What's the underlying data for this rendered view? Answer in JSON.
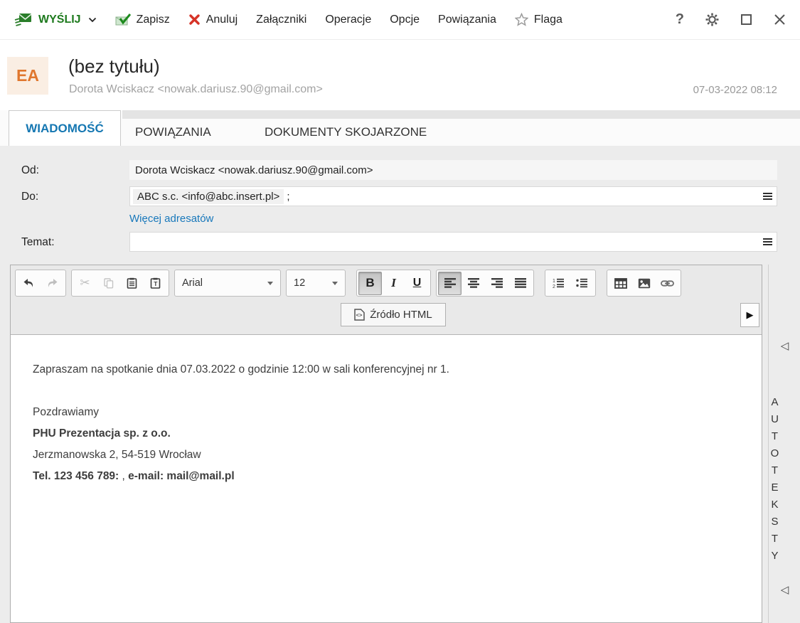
{
  "toolbar": {
    "send_label": "WYŚLIJ",
    "save_label": "Zapisz",
    "cancel_label": "Anuluj",
    "attachments_label": "Załączniki",
    "operations_label": "Operacje",
    "options_label": "Opcje",
    "relations_label": "Powiązania",
    "flag_label": "Flaga",
    "help_label": "?"
  },
  "header": {
    "avatar_initials": "EA",
    "title": "(bez tytułu)",
    "sender_line": "Dorota Wciskacz <nowak.dariusz.90@gmail.com>",
    "datetime": "07-03-2022 08:12"
  },
  "tabs": [
    {
      "label": "WIADOMOŚĆ"
    },
    {
      "label": "POWIĄZANIA"
    },
    {
      "label": "DOKUMENTY SKOJARZONE"
    }
  ],
  "form": {
    "from_label": "Od:",
    "from_value": "Dorota Wciskacz <nowak.dariusz.90@gmail.com>",
    "to_label": "Do:",
    "to_chip": "ABC s.c. <info@abc.insert.pl>",
    "to_suffix": ";",
    "more_recipients_link": "Więcej adresatów",
    "subject_label": "Temat:",
    "subject_value": ""
  },
  "editor": {
    "font_name": "Arial",
    "font_size": "12",
    "bold_label": "B",
    "italic_label": "I",
    "underline_label": "U",
    "source_button_label": "Źródło HTML",
    "expand_glyph": "▶",
    "body": {
      "paragraph1": "Zapraszam na spotkanie dnia 07.03.2022 o godzinie 12:00 w sali konferencyjnej nr 1.",
      "greeting": "Pozdrawiamy",
      "company": "PHU Prezentacja sp. z o.o.",
      "address": "Jerzmanowska 2, 54-519 Wrocław",
      "phone_bold": "Tel. 123 456 789:",
      "phone_separator": " , ",
      "email_bold": "e-mail: mail@mail.pl"
    }
  },
  "side_panel": {
    "label": "AUTOTEKSTY",
    "collapse_glyph": "◁"
  },
  "colors": {
    "accent_green": "#1e7a1e",
    "accent_red": "#d63327",
    "accent_blue": "#1577b2",
    "avatar_bg": "#faeee3",
    "avatar_text": "#e0772e",
    "content_bg": "#ececec"
  }
}
